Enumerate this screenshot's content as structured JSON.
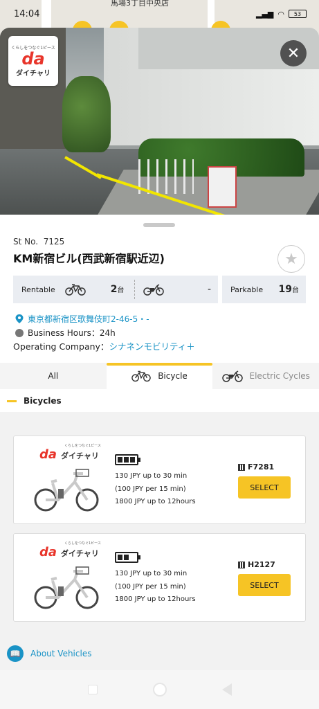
{
  "status_bar": {
    "time": "14:04",
    "battery": "53"
  },
  "map": {
    "label": "馬場3丁目中央店"
  },
  "station": {
    "number_label": "St No.",
    "number": "7125",
    "name": "KM新宿ビル(西武新宿駅近辺)",
    "address": "東京都新宿区歌舞伎町2-46-5・-",
    "business_hours": "Business Hours：24h",
    "operating_label": "Operating Company：",
    "operating_company": "シナネンモビリティ＋"
  },
  "counts": {
    "rentable_label": "Rentable",
    "bicycle_count": "2",
    "unit": "台",
    "electric_count": "-",
    "parkable_label": "Parkable",
    "parkable_count": "19"
  },
  "tabs": [
    {
      "label": "All"
    },
    {
      "label": "Bicycle"
    },
    {
      "label": "Electric Cycles"
    }
  ],
  "section": {
    "title": "Bicycles"
  },
  "bikes": [
    {
      "brand": "ダイチャリ",
      "brand_tagline": "くらしをつなぐ1ピース",
      "prices": [
        "130 JPY up to 30 min",
        "(100 JPY per 15 min)",
        "1800 JPY up to 12hours"
      ],
      "id": "F7281",
      "select_label": "SELECT",
      "battery_bars": 3
    },
    {
      "brand": "ダイチャリ",
      "brand_tagline": "くらしをつなぐ1ピース",
      "prices": [
        "130 JPY up to 30 min",
        "(100 JPY per 15 min)",
        "1800 JPY up to 12hours"
      ],
      "id": "H2127",
      "select_label": "SELECT",
      "battery_bars": 2
    }
  ],
  "footer": {
    "about_label": "About Vehicles"
  },
  "logo": {
    "mark": "da",
    "text": "ダイチャリ",
    "tagline": "くらしをつなぐ1ピース"
  },
  "colors": {
    "accent": "#f6c425",
    "link": "#1a93c6",
    "brand_red": "#e8352b"
  }
}
